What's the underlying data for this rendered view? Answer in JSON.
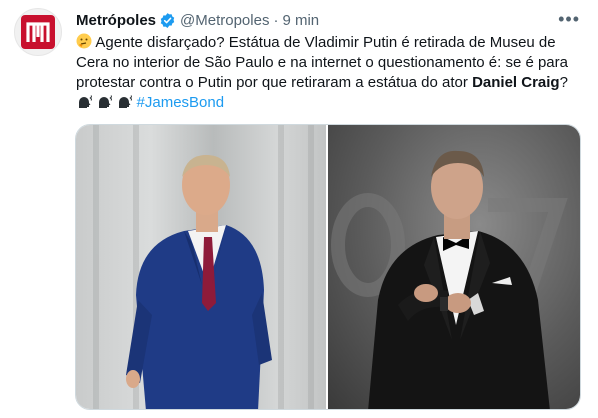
{
  "tweet": {
    "author_name": "Metrópoles",
    "handle": "@Metropoles",
    "separator": "·",
    "time": "9 min",
    "more_label": "•••",
    "text_part1": "Agente disfarçado? Estátua de Vladimir Putin é retirada de Museu de Cera no interior de São Paulo e na internet o questionamento é: se é para protestar contra o Putin por que retiraram a estátua do ator ",
    "text_bold": "Daniel Craig",
    "text_part2": "?",
    "hashtag": "#JamesBond"
  },
  "icons": {
    "avatar": "metropoles-logo",
    "verified": "verified-badge-icon",
    "thinking": "thinking-face-emoji",
    "speaking": "speaking-head-emoji",
    "more": "more-icon"
  },
  "colors": {
    "brand": "#c8102e",
    "verified": "#1d9bf0",
    "hashtag": "#1d9bf0",
    "secondary_text": "#536471"
  },
  "media": {
    "images": [
      "putin-wax-statue-photo",
      "daniel-craig-photo"
    ]
  }
}
